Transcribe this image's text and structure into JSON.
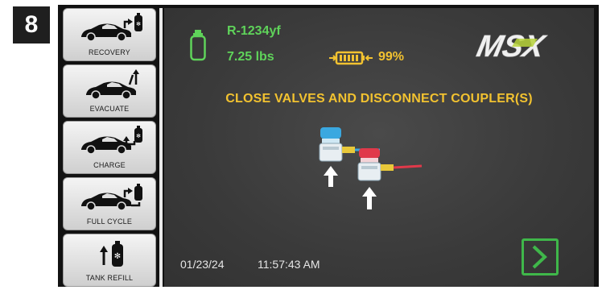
{
  "step_number": "8",
  "sidebar": {
    "items": [
      {
        "label": "RECOVERY",
        "icon": "car-recovery-icon"
      },
      {
        "label": "EVACUATE",
        "icon": "car-evacuate-icon"
      },
      {
        "label": "CHARGE",
        "icon": "car-charge-icon"
      },
      {
        "label": "FULL CYCLE",
        "icon": "car-full-cycle-icon"
      },
      {
        "label": "TANK REFILL",
        "icon": "tank-refill-icon"
      }
    ]
  },
  "status": {
    "refrigerant": "R-1234yf",
    "weight": "7.25 lbs",
    "battery_percent": "99%"
  },
  "brand": "MSX",
  "message": "CLOSE VALVES AND DISCONNECT COUPLER(S)",
  "footer": {
    "date": "01/23/24",
    "time": "11:57:43 AM"
  },
  "colors": {
    "status_green": "#5fd35a",
    "message_yellow": "#f2c230",
    "next_green": "#3fb74a",
    "low_side_blue": "#3aa8e0",
    "high_side_red": "#e0394a"
  }
}
